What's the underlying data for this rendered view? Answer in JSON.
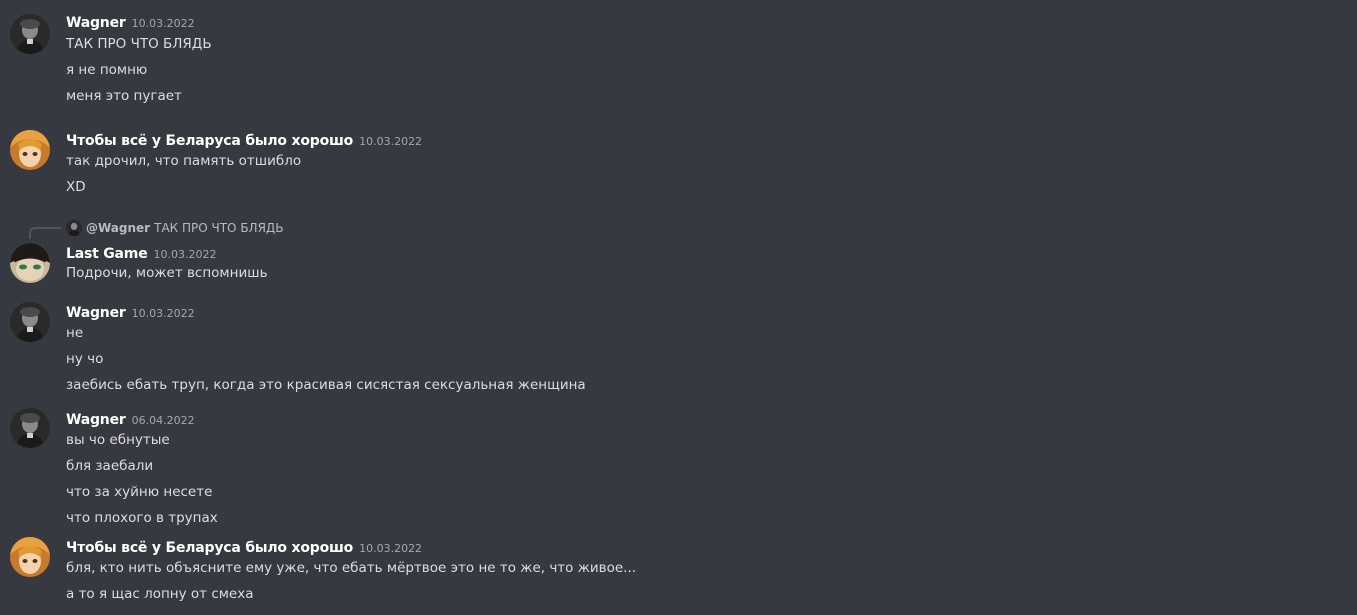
{
  "messages": [
    {
      "author": "Wagner",
      "avatar": "wagner-avatar",
      "timestamp": "10.03.2022",
      "lines": [
        "ТАК ПРО ЧТО БЛЯДЬ",
        "я не помню",
        "меня это пугает"
      ]
    },
    {
      "author": "Чтобы всё у Беларуса было хорошо",
      "avatar": "blonde-anime-avatar",
      "timestamp": "10.03.2022",
      "lines": [
        "так дрочил, что память отшибло",
        "XD"
      ]
    },
    {
      "author": "Last Game",
      "avatar": "green-eyed-anime-avatar",
      "timestamp": "10.03.2022",
      "reply": {
        "author": "@Wagner",
        "text": "ТАК ПРО ЧТО БЛЯДЬ"
      },
      "lines": [
        "Подрочи, может вспомнишь"
      ]
    },
    {
      "author": "Wagner",
      "avatar": "wagner-avatar",
      "timestamp": "10.03.2022",
      "lines": [
        "не",
        "ну чо",
        "заебись ебать труп, когда это красивая сисястая сексуальная женщина"
      ]
    },
    {
      "author": "Wagner",
      "avatar": "wagner-avatar",
      "timestamp": "06.04.2022",
      "lines": [
        "вы чо ебнутые",
        "бля заебали",
        "что за хуйню несете",
        "что плохого в трупах"
      ]
    },
    {
      "author": "Чтобы всё у Беларуса было хорошо",
      "avatar": "blonde-anime-avatar",
      "timestamp": "10.03.2022",
      "lines": [
        "бля, кто нить объясните ему уже, что ебать мёртвое это не то же, что живое...",
        "а то я щас лопну от смеха"
      ]
    }
  ],
  "colors": {
    "background": "#36393f",
    "username": "#ffffff",
    "timestamp": "#a3a6aa",
    "message_text": "#dcddde"
  }
}
